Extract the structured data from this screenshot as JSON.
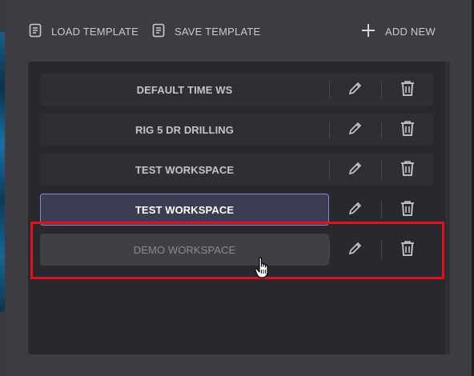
{
  "toolbar": {
    "load_label": "LOAD TEMPLATE",
    "save_label": "SAVE TEMPLATE",
    "add_label": "ADD NEW"
  },
  "workspaces": [
    {
      "name": "DEFAULT TIME WS",
      "state": "normal"
    },
    {
      "name": "RIG 5 DR DRILLING",
      "state": "normal"
    },
    {
      "name": "TEST WORKSPACE",
      "state": "normal"
    },
    {
      "name": "TEST WORKSPACE",
      "state": "selected"
    },
    {
      "name": "DEMO WORKSPACE",
      "state": "dragging"
    }
  ],
  "colors": {
    "accent_border": "#8e88c9",
    "highlight": "#e0121a",
    "text": "#c3c3c9"
  },
  "icons": {
    "load": "document-icon",
    "save": "document-icon",
    "add": "plus-icon",
    "edit": "pencil-icon",
    "delete": "trash-icon",
    "cursor": "hand-pointer-icon"
  }
}
